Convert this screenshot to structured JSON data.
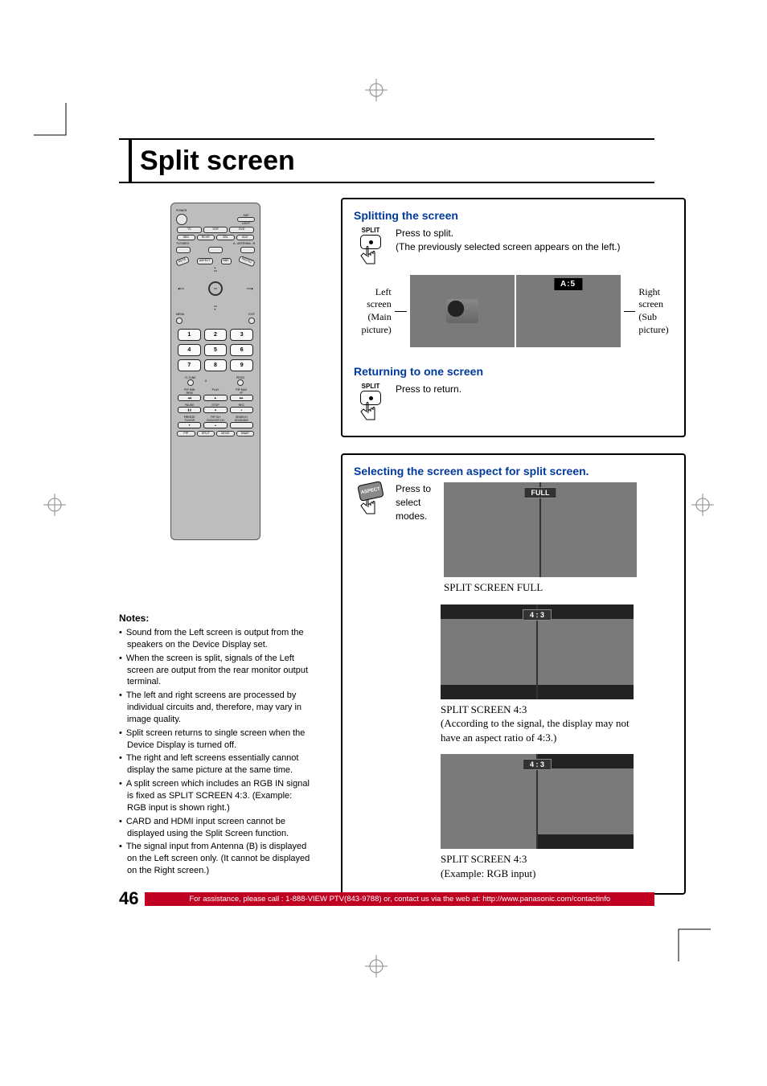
{
  "page_title": "Split screen",
  "remote": {
    "top": {
      "power": "POWER",
      "sap": "SAP",
      "light": "LIGHT"
    },
    "mode_row": [
      "TV",
      "VCR",
      "DVD"
    ],
    "mode_row2": [
      "DBS",
      "RCVR",
      "CBL",
      "AUX"
    ],
    "tvvideo": "TV/VIDEO",
    "ant": "A - ANTENNA - B",
    "mid": [
      "MUTE",
      "ASPECT",
      "BBE",
      "RECALL"
    ],
    "ch": "CH",
    "vol": "VOL",
    "ok": "OK",
    "menu": "MENU",
    "exit": "EXIT",
    "nums": [
      "1",
      "2",
      "3",
      "4",
      "5",
      "6",
      "7",
      "8",
      "9"
    ],
    "rtune": "R-TUNE",
    "zero": "0",
    "prog": "PROG",
    "row_a": [
      "PIP MIN",
      "PLAY",
      "PIP MAX"
    ],
    "row_a2": [
      "REW",
      "",
      "FF"
    ],
    "row_b": [
      "PAUSE",
      "STOP",
      "REC"
    ],
    "row_c": [
      "FREEZE",
      "PIP CH",
      "SEARCH"
    ],
    "row_c2": [
      "TV/VCR",
      "DVD/VCR CH",
      "SD/GUIDE"
    ],
    "row_d": [
      "PIP",
      "SPLIT",
      "MOVE",
      "SWAP"
    ]
  },
  "notes": {
    "heading": "Notes:",
    "items": [
      "Sound from the Left screen is output from the speakers on the Device Display set.",
      "When the screen is split, signals of the Left screen are output from the rear monitor output terminal.",
      "The left and right screens are processed by individual circuits and, therefore, may vary in image quality.",
      "Split screen returns to single screen when the Device Display is turned off.",
      "The right and left screens essentially cannot display the same picture at the same time.",
      "A split screen which includes an RGB IN signal is fixed as SPLIT SCREEN 4:3. (Example: RGB input is shown right.)",
      "CARD and HDMI input screen cannot be displayed using the Split Screen function.",
      "The signal input from Antenna (B) is displayed on the Left screen only. (It cannot be displayed on the Right screen.)"
    ]
  },
  "section1": {
    "h_split": "Splitting the screen",
    "split_label": "SPLIT",
    "split_text1": "Press to split.",
    "split_text2": "(The previously selected screen appears on the left.)",
    "badge_a5": "A:5",
    "left_label1": "Left screen",
    "left_label2": "(Main picture)",
    "right_label1": "Right screen",
    "right_label2": "(Sub picture)",
    "h_return": "Returning to one screen",
    "return_text": "Press to return."
  },
  "section2": {
    "heading": "Selecting the screen aspect for split screen.",
    "aspect_label": "ASPECT",
    "press_text": "Press to select modes.",
    "badge_full": "FULL",
    "cap_full": "SPLIT SCREEN FULL",
    "badge_43": "4 : 3",
    "cap_43a": "SPLIT SCREEN 4:3",
    "cap_43a_sub": "(According to the signal, the display may not have an aspect ratio of 4:3.)",
    "cap_43b": "SPLIT SCREEN 4:3",
    "cap_43b_sub": "(Example: RGB input)"
  },
  "footer": {
    "page": "46",
    "text": "For assistance, please call : 1-888-VIEW PTV(843-9788) or, contact us via the web at: http://www.panasonic.com/contactinfo"
  }
}
